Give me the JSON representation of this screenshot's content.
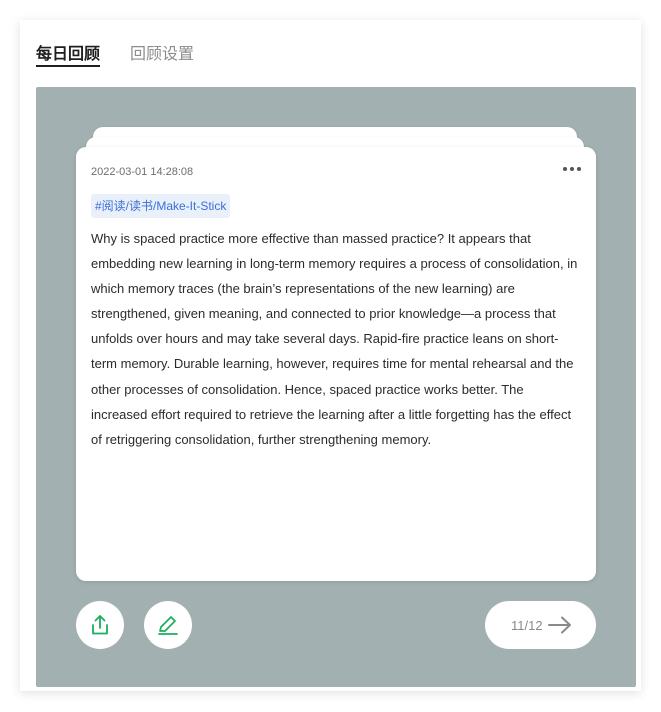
{
  "tabs": [
    {
      "label": "每日回顾",
      "active": true
    },
    {
      "label": "回顾设置",
      "active": false
    }
  ],
  "card": {
    "timestamp": "2022-03-01 14:28:08",
    "tag": "#阅读/读书/Make-It-Stick",
    "body": "Why is spaced practice more effective than massed practice? It appears that embedding new learning in long-term memory requires a process of consolidation, in which memory traces (the brain’s representations of the new learning) are strengthened, given meaning, and connected to prior knowledge—a process that unfolds over hours and may take several days. Rapid-fire practice leans on short-term memory. Durable learning, however, requires time for mental rehearsal and the other processes of consolidation. Hence, spaced practice works better. The increased effort required to retrieve the learning after a little forgetting has the effect of retriggering consolidation, further strengthening memory."
  },
  "pager": {
    "count": "11/12"
  },
  "icons": {
    "more": "more-dots-icon",
    "share": "share-icon",
    "edit": "pencil-icon",
    "next": "arrow-right-icon"
  },
  "colors": {
    "stage_bg": "#a2b0b1",
    "accent_green": "#1aaf5d",
    "tag_text": "#3b6fd6",
    "tag_bg": "#e9f0fa"
  }
}
